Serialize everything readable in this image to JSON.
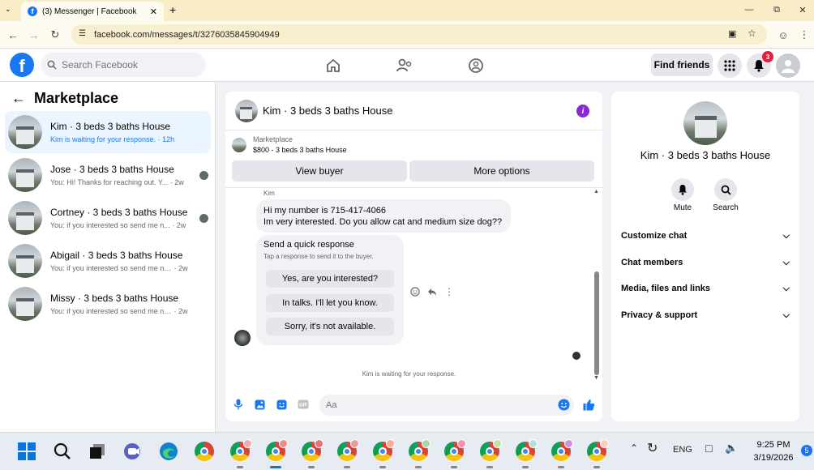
{
  "browser": {
    "tab_title": "(3) Messenger | Facebook",
    "url": "facebook.com/messages/t/3276035845904949"
  },
  "header": {
    "search_placeholder": "Search Facebook",
    "find_friends": "Find friends",
    "notification_count": "3"
  },
  "left": {
    "title": "Marketplace",
    "conversations": [
      {
        "name": "Kim · 3 beds 3 baths House",
        "snippet": "Kim is waiting for your response.",
        "time": "· 12h",
        "active": true
      },
      {
        "name": "Jose · 3 beds 3 baths House",
        "snippet": "You: Hi! Thanks for reaching out. Y...",
        "time": "· 2w"
      },
      {
        "name": "Cortney · 3 beds 3 baths House",
        "snippet": "You: if you interested so send me n...",
        "time": "· 2w"
      },
      {
        "name": "Abigail · 3 beds 3 baths House",
        "snippet": "You: if you interested so send me nu...",
        "time": "· 2w"
      },
      {
        "name": "Missy · 3 beds 3 baths House",
        "snippet": "You: if you interested so send me nu...",
        "time": "· 2w"
      }
    ]
  },
  "chat": {
    "title": "Kim · 3 beds 3 baths House",
    "marketplace_label": "Marketplace",
    "listing": "$800 - 3 beds 3 baths House",
    "view_buyer": "View buyer",
    "more_options": "More options",
    "sender": "Kim",
    "message_line1": "Hi my number is 715-417-4066",
    "message_line2": "Im very interested.  Do you allow cat and medium size dog??",
    "quick_title": "Send a quick response",
    "quick_sub": "Tap a response to send it to the buyer.",
    "quick_responses": [
      "Yes, are you interested?",
      "In talks. I'll let you know.",
      "Sorry, it's not available."
    ],
    "waiting": "Kim is waiting for your response.",
    "input_placeholder": "Aa"
  },
  "right": {
    "name": "Kim · 3 beds 3 baths House",
    "mute": "Mute",
    "search": "Search",
    "rows": [
      "Customize chat",
      "Chat members",
      "Media, files and links",
      "Privacy & support"
    ]
  },
  "taskbar": {
    "lang": "ENG",
    "time": "9:25 PM",
    "date": "3/19/2026",
    "notif_count": "5"
  },
  "colors": {
    "accent": "#1877f2",
    "info": "#8a28d8",
    "badge": "#e41e3f"
  }
}
